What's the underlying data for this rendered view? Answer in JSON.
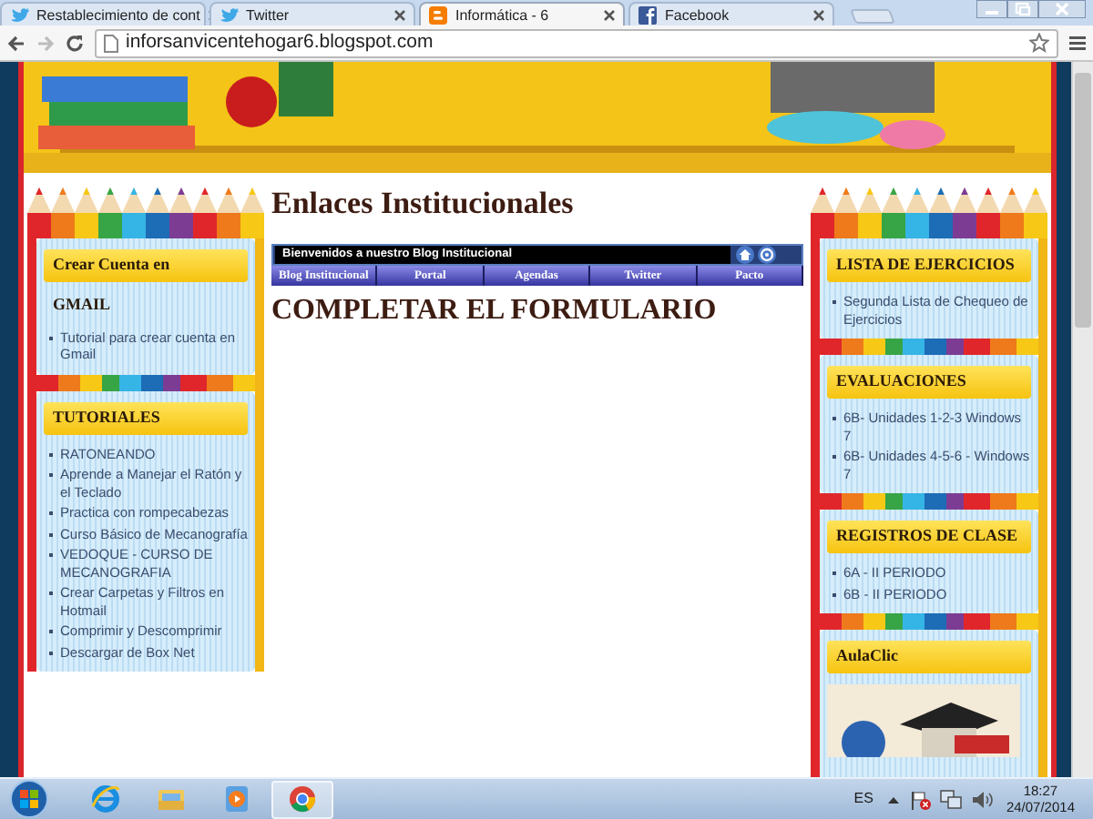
{
  "browser": {
    "tabs": [
      {
        "kind": "twitter",
        "title": "Restablecimiento de cont",
        "selected": false
      },
      {
        "kind": "twitter",
        "title": "Twitter",
        "selected": false
      },
      {
        "kind": "blogger",
        "title": "Informática - 6",
        "selected": true
      },
      {
        "kind": "facebook",
        "title": "Facebook",
        "selected": false
      }
    ],
    "toolbar": {
      "forward_disabled": true,
      "address": "inforsanvicentehogar6.blogspot.com"
    }
  },
  "page": {
    "title": "Enlaces Institucionales",
    "welcome": "Bienvenidos a nuestro Blog Institucional",
    "menu": [
      "Blog Institucional",
      "Portal",
      "Agendas",
      "Twitter",
      "Pacto"
    ],
    "heading": "COMPLETAR EL FORMULARIO"
  },
  "left_sidebar": [
    {
      "kind": "links",
      "title": "Crear Cuenta en",
      "title_overflow": "GMAIL",
      "links": [
        "Tutorial para crear cuenta en Gmail"
      ]
    },
    {
      "kind": "links",
      "title": "TUTORIALES",
      "links": [
        "RATONEANDO",
        "Aprende a Manejar el Ratón y el Teclado",
        "Practica con rompecabezas",
        "Curso Básico de Mecanografía",
        "VEDOQUE - CURSO DE MECANOGRAFIA",
        "Crear Carpetas y Filtros en Hotmail",
        "Comprimir y Descomprimir",
        "Descargar de Box Net"
      ]
    }
  ],
  "right_sidebar": [
    {
      "kind": "links",
      "title": "LISTA DE EJERCICIOS",
      "links": [
        "Segunda Lista de Chequeo de Ejercicios"
      ]
    },
    {
      "kind": "links",
      "title": "EVALUACIONES",
      "links": [
        "6B- Unidades 1-2-3 Windows 7",
        "6B- Unidades 4-5-6 - Windows 7"
      ]
    },
    {
      "kind": "links",
      "title": "REGISTROS DE CLASE",
      "links": [
        "6A - II PERIODO",
        "6B - II PERIODO"
      ]
    },
    {
      "kind": "picture",
      "title": "AulaClic"
    }
  ],
  "taskbar": {
    "apps": [
      {
        "kind": "ie",
        "selected": false
      },
      {
        "kind": "explorer",
        "selected": false
      },
      {
        "kind": "media",
        "selected": false
      },
      {
        "kind": "chrome",
        "selected": true
      }
    ],
    "language": "ES",
    "time": "18:27",
    "date": "24/07/2014"
  }
}
